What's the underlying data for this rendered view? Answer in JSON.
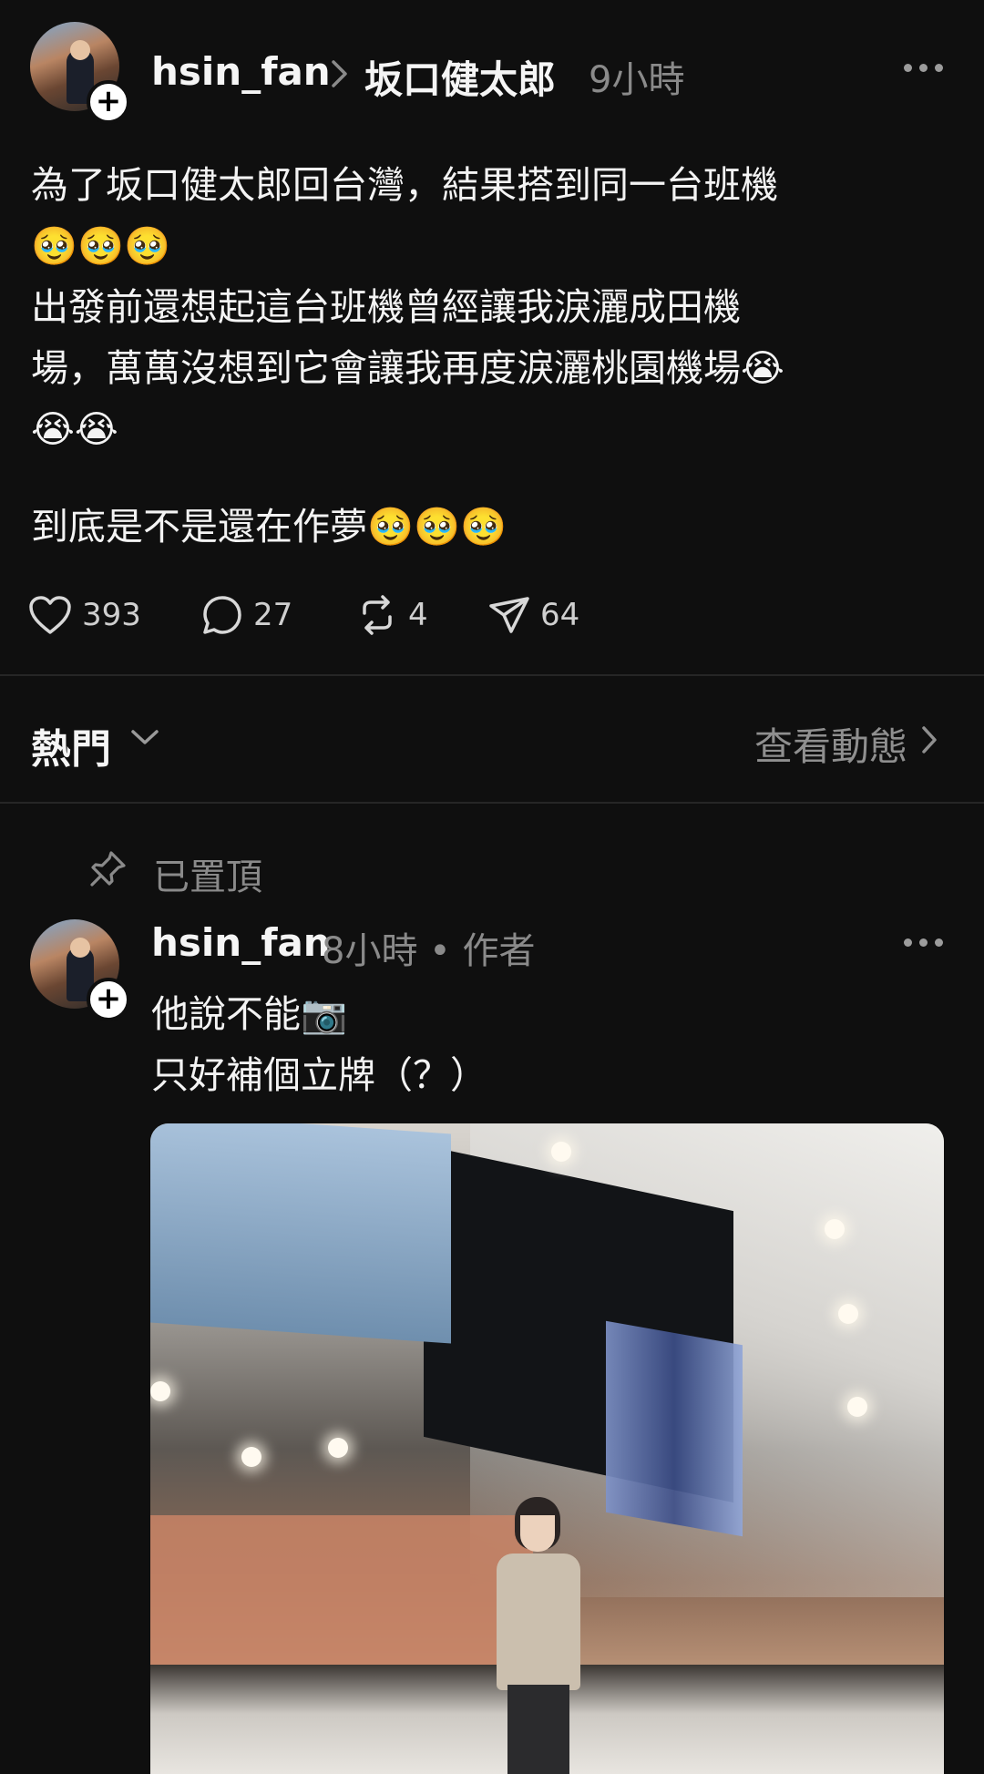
{
  "post": {
    "username": "hsin_fan",
    "topic": "坂口健太郎",
    "time": "9小時",
    "body": "為了坂口健太郎回台灣，結果搭到同一台班機\n🥹🥹🥹\n出發前還想起這台班機曾經讓我淚灑成田機\n場，萬萬沒想到它會讓我再度淚灑桃園機場😭\n😭😭",
    "body2": "到底是不是還在作夢🥹🥹🥹",
    "likes": "393",
    "comments": "27",
    "reposts": "4",
    "shares": "64"
  },
  "replies_header": {
    "sort_label": "熱門",
    "activity_link": "查看動態"
  },
  "pinned_reply": {
    "pinned_label": "已置頂",
    "username": "hsin_fan",
    "meta": "8小時 • 作者",
    "body": "他說不能📷\n只好補個立牌（？）"
  },
  "colors": {
    "background": "#0f0f0f",
    "text": "#f3f3f3",
    "muted": "#8a8a8a",
    "divider": "#262626"
  },
  "icons": [
    "heart-icon",
    "comment-icon",
    "repost-icon",
    "share-icon",
    "more-icon",
    "chevron-down-icon",
    "chevron-right-icon",
    "pin-icon",
    "follow-plus-icon"
  ]
}
